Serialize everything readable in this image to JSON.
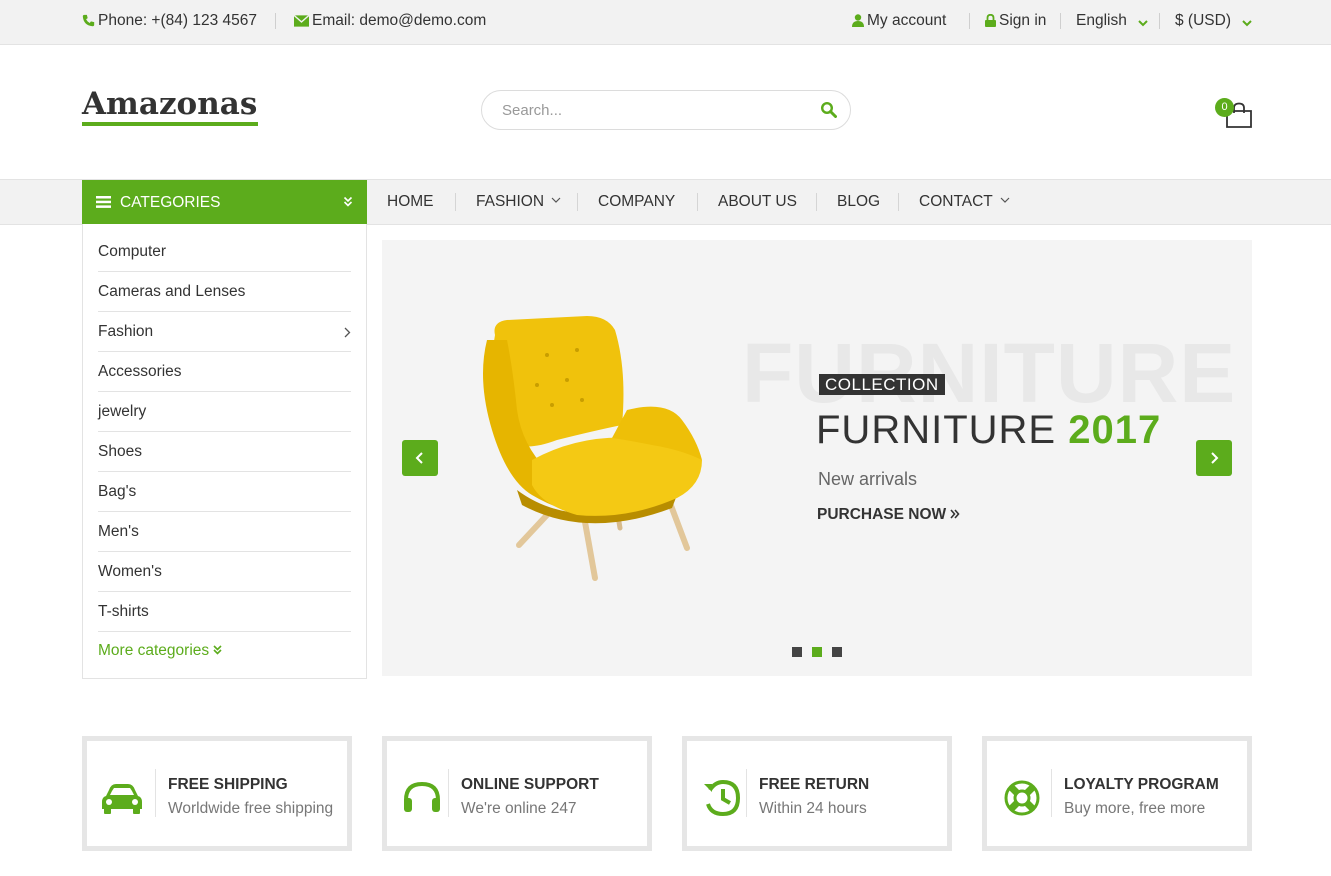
{
  "topbar": {
    "phone": "Phone: +(84) 123 4567",
    "email": "Email: demo@demo.com",
    "my_account": "My account",
    "sign_in": "Sign in",
    "language": "English",
    "currency": "$ (USD)"
  },
  "header": {
    "logo": "Amazonas",
    "search_placeholder": "Search...",
    "cart_count": "0"
  },
  "categories": {
    "title": "CATEGORIES",
    "items": [
      "Computer",
      "Cameras and Lenses",
      "Fashion",
      "Accessories",
      "jewelry",
      "Shoes",
      "Bag's",
      "Men's",
      "Women's",
      "T-shirts"
    ],
    "more": "More categories"
  },
  "menu": [
    "HOME",
    "FASHION",
    "COMPANY",
    "ABOUT US",
    "BLOG",
    "CONTACT"
  ],
  "slider": {
    "watermark": "FURNITURE",
    "badge": "COLLECTION",
    "headline": "FURNITURE",
    "year": "2017",
    "subline": "New arrivals",
    "cta": "PURCHASE NOW",
    "active_slide": 2,
    "slide_count": 3
  },
  "features": [
    {
      "title": "FREE SHIPPING",
      "subtitle": "Worldwide free shipping",
      "icon": "car-icon"
    },
    {
      "title": "ONLINE SUPPORT",
      "subtitle": "We're online 247",
      "icon": "headphones-icon"
    },
    {
      "title": "FREE RETURN",
      "subtitle": "Within 24 hours",
      "icon": "history-icon"
    },
    {
      "title": "LOYALTY PROGRAM",
      "subtitle": "Buy more, free more",
      "icon": "life-ring-icon"
    }
  ],
  "colors": {
    "accent": "#5cac1c",
    "dark": "#333333"
  }
}
